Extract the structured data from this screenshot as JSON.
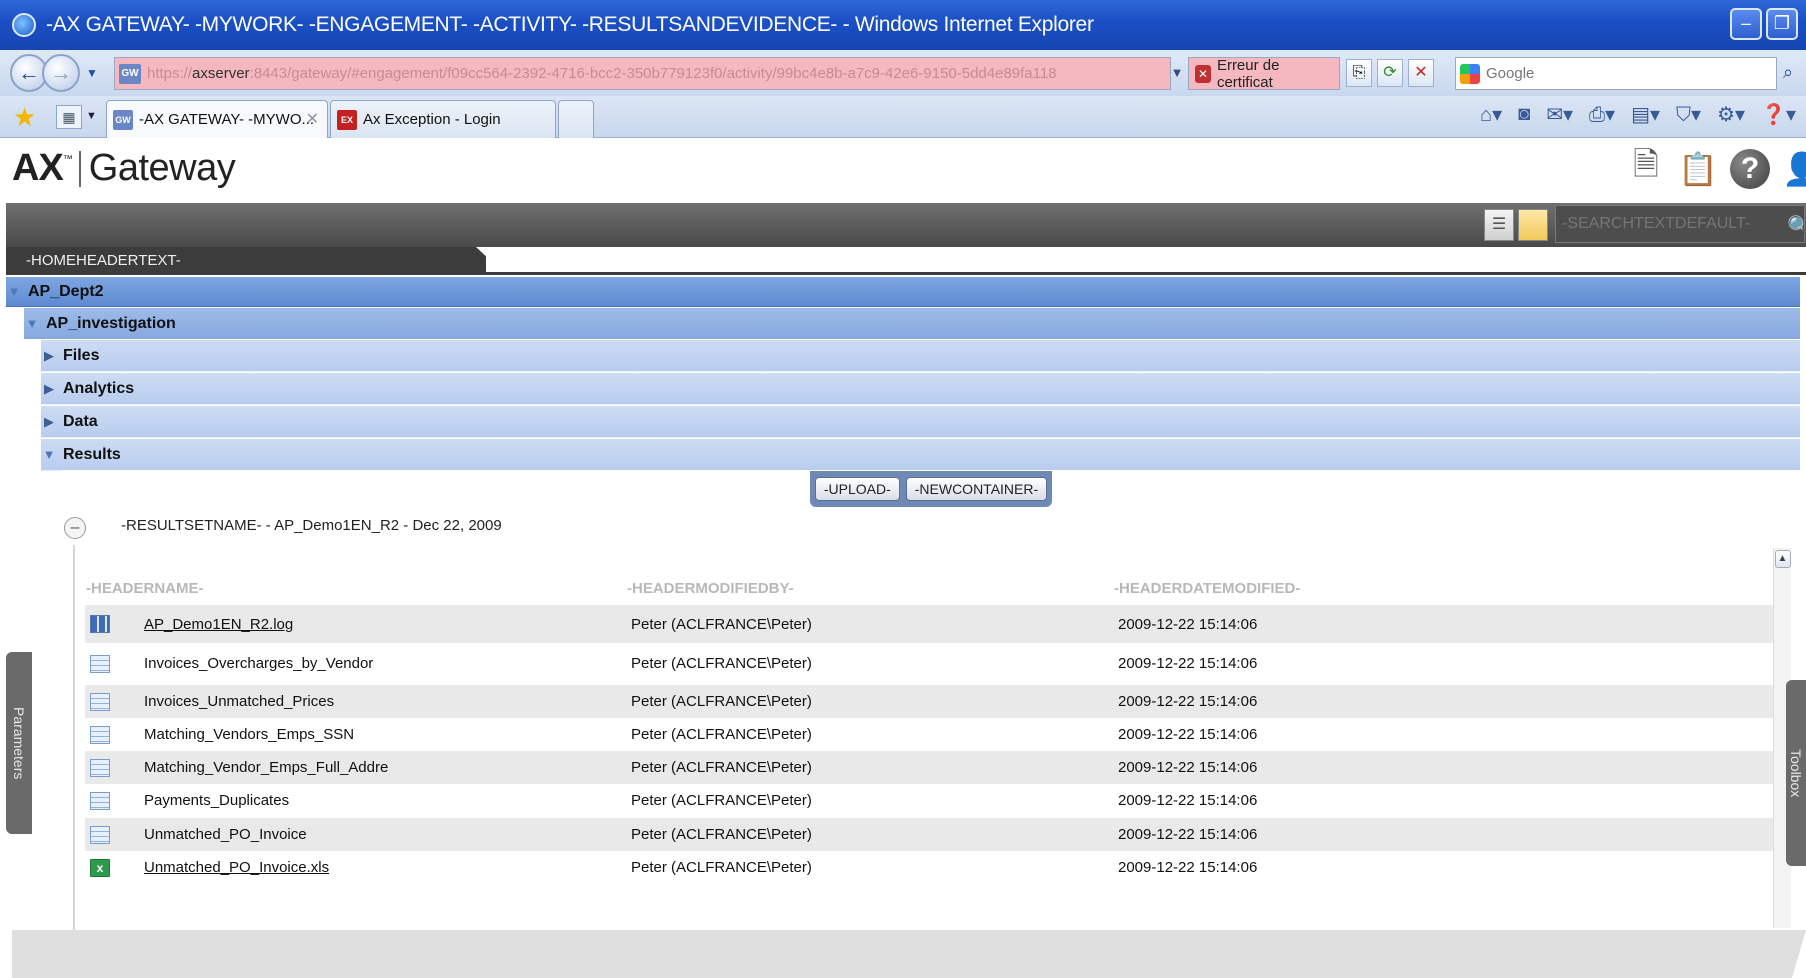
{
  "browser": {
    "title": "-AX GATEWAY- -MYWORK- -ENGAGEMENT- -ACTIVITY- -RESULTSANDEVIDENCE- - Windows Internet Explorer",
    "url_prefix": "https://",
    "url_host": "axserver",
    "url_rest": ":8443/gateway/#engagement/f09cc564-2392-4716-bcc2-350b779123f0/activity/99bc4e8b-a7c9-42e6-9150-5dd4e89fa118",
    "cert_error": "Erreur de certificat",
    "search_placeholder": "Google",
    "tabs": [
      {
        "label": "-AX GATEWAY- -MYWO...",
        "favicon": "GW"
      },
      {
        "label": "Ax Exception - Login",
        "favicon": "EX"
      }
    ]
  },
  "app": {
    "logo_ax": "AX",
    "logo_tm": "™",
    "logo_name": "Gateway",
    "search_placeholder": "-SEARCHTEXTDEFAULT-",
    "home_header": "-HOMEHEADERTEXT-"
  },
  "tree": {
    "dept": "AP_Dept2",
    "investigation": "AP_investigation",
    "sections": [
      "Files",
      "Analytics",
      "Data",
      "Results"
    ]
  },
  "results": {
    "upload_label": "-UPLOAD-",
    "newcontainer_label": "-NEWCONTAINER-",
    "resultset_title": "-RESULTSETNAME- - AP_Demo1EN_R2 - Dec 22, 2009",
    "columns": [
      "-HEADERNAME-",
      "-HEADERMODIFIEDBY-",
      "-HEADERDATEMODIFIED-"
    ],
    "rows": [
      {
        "name": "AP_Demo1EN_R2.log",
        "modified_by": "Peter (ACLFRANCE\\Peter)",
        "date": "2009-12-22 15:14:06",
        "icon": "log-file-icon"
      },
      {
        "name": "Invoices_Overcharges_by_Vendor",
        "modified_by": "Peter (ACLFRANCE\\Peter)",
        "date": "2009-12-22 15:14:06",
        "icon": "table-icon"
      },
      {
        "name": "Invoices_Unmatched_Prices",
        "modified_by": "Peter (ACLFRANCE\\Peter)",
        "date": "2009-12-22 15:14:06",
        "icon": "table-icon"
      },
      {
        "name": "Matching_Vendors_Emps_SSN",
        "modified_by": "Peter (ACLFRANCE\\Peter)",
        "date": "2009-12-22 15:14:06",
        "icon": "table-icon"
      },
      {
        "name": "Matching_Vendor_Emps_Full_Addre",
        "modified_by": "Peter (ACLFRANCE\\Peter)",
        "date": "2009-12-22 15:14:06",
        "icon": "table-icon"
      },
      {
        "name": "Payments_Duplicates",
        "modified_by": "Peter (ACLFRANCE\\Peter)",
        "date": "2009-12-22 15:14:06",
        "icon": "table-icon"
      },
      {
        "name": "Unmatched_PO_Invoice",
        "modified_by": "Peter (ACLFRANCE\\Peter)",
        "date": "2009-12-22 15:14:06",
        "icon": "table-icon"
      },
      {
        "name": "Unmatched_PO_Invoice.xls",
        "modified_by": "Peter (ACLFRANCE\\Peter)",
        "date": "2009-12-22 15:14:06",
        "icon": "excel-file-icon"
      }
    ]
  },
  "side": {
    "parameters": "Parameters",
    "toolbox": "Toolbox"
  }
}
